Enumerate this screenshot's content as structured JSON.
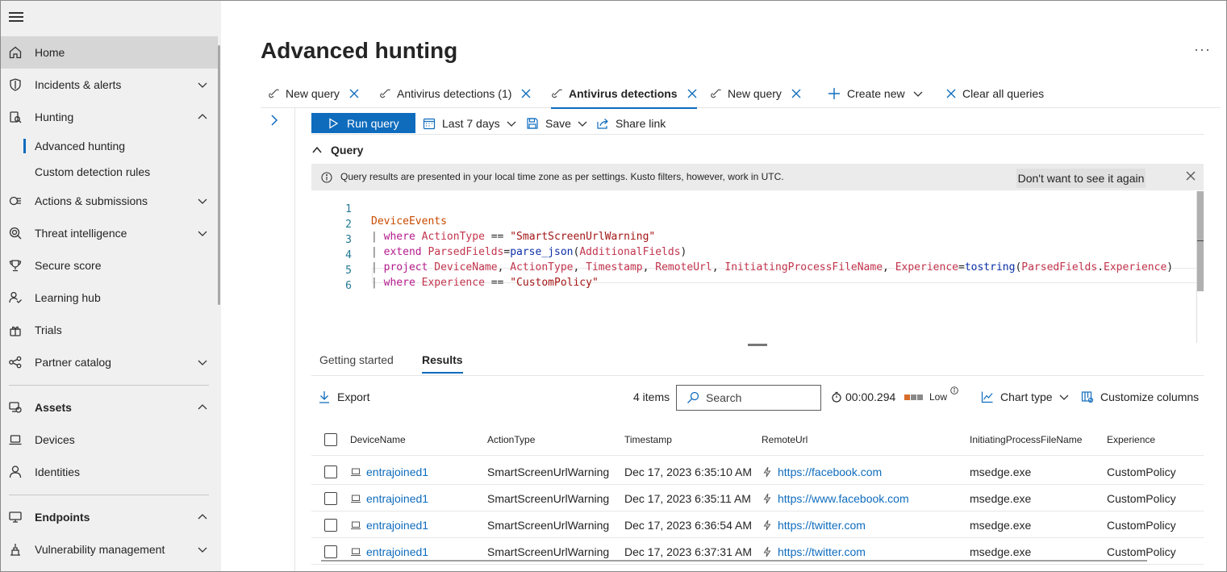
{
  "sidebar": {
    "items": [
      {
        "label": "Home",
        "icon": "home-icon"
      },
      {
        "label": "Incidents & alerts",
        "icon": "shield-icon"
      },
      {
        "label": "Hunting",
        "icon": "hunting-icon"
      },
      {
        "label": "Advanced hunting"
      },
      {
        "label": "Custom detection rules"
      },
      {
        "label": "Actions & submissions",
        "icon": "actions-icon"
      },
      {
        "label": "Threat intelligence",
        "icon": "threat-intel-icon"
      },
      {
        "label": "Secure score",
        "icon": "trophy-icon"
      },
      {
        "label": "Learning hub",
        "icon": "learning-icon"
      },
      {
        "label": "Trials",
        "icon": "trials-icon"
      },
      {
        "label": "Partner catalog",
        "icon": "partner-icon"
      },
      {
        "label": "Assets",
        "icon": "assets-icon"
      },
      {
        "label": "Devices",
        "icon": "laptop-icon"
      },
      {
        "label": "Identities",
        "icon": "person-icon"
      },
      {
        "label": "Endpoints",
        "icon": "endpoints-icon"
      },
      {
        "label": "Vulnerability management",
        "icon": "vuln-icon"
      }
    ]
  },
  "page": {
    "title": "Advanced hunting",
    "more": "···"
  },
  "query_tabs": [
    {
      "label": "New query"
    },
    {
      "label": "Antivirus detections (1)"
    },
    {
      "label": "Antivirus detections"
    },
    {
      "label": "New query"
    }
  ],
  "tab_actions": {
    "create_new": "Create new",
    "clear_all": "Clear all queries"
  },
  "toolbar": {
    "run": "Run query",
    "range": "Last 7 days",
    "save": "Save",
    "share": "Share link"
  },
  "query_section": {
    "title": "Query",
    "info_text": "Query results are presented in your local time zone as per settings. Kusto filters, however, work in UTC.",
    "info_button": "Don't want to see it again"
  },
  "code": {
    "line_numbers": [
      "1",
      "2",
      "3",
      "4",
      "5",
      "6"
    ],
    "l1": "DeviceEvents",
    "l2_kw": "where",
    "l2_fld": "ActionType",
    "l2_op": "==",
    "l2_str": "\"SmartScreenUrlWarning\"",
    "l3_kw": "extend",
    "l3_fld": "ParsedFields",
    "l3_fn": "parse_json",
    "l3_arg": "AdditionalFields",
    "l4_kw": "project",
    "l4_f1": "DeviceName",
    "l4_f2": "ActionType",
    "l4_f3": "Timestamp",
    "l4_f4": "RemoteUrl",
    "l4_f5": "InitiatingProcessFileName",
    "l4_f6": "Experience",
    "l4_fn": "tostring",
    "l4_a1": "ParsedFields",
    "l4_a2": "Experience",
    "l5_kw": "where",
    "l5_fld": "Experience",
    "l5_op": "==",
    "l5_str": "\"CustomPolicy\""
  },
  "result_tabs": {
    "getting_started": "Getting started",
    "results": "Results"
  },
  "results_toolbar": {
    "export": "Export",
    "count": "4 items",
    "search_placeholder": "Search",
    "duration": "00:00.294",
    "usage": "Low",
    "chart_type": "Chart type",
    "customize": "Customize columns"
  },
  "table": {
    "columns": [
      "DeviceName",
      "ActionType",
      "Timestamp",
      "RemoteUrl",
      "InitiatingProcessFileName",
      "Experience"
    ],
    "rows": [
      {
        "device": "entrajoined1",
        "action": "SmartScreenUrlWarning",
        "time": "Dec 17, 2023 6:35:10 AM",
        "url": "https://facebook.com",
        "proc": "msedge.exe",
        "exp": "CustomPolicy"
      },
      {
        "device": "entrajoined1",
        "action": "SmartScreenUrlWarning",
        "time": "Dec 17, 2023 6:35:11 AM",
        "url": "https://www.facebook.com",
        "proc": "msedge.exe",
        "exp": "CustomPolicy"
      },
      {
        "device": "entrajoined1",
        "action": "SmartScreenUrlWarning",
        "time": "Dec 17, 2023 6:36:54 AM",
        "url": "https://twitter.com",
        "proc": "msedge.exe",
        "exp": "CustomPolicy"
      },
      {
        "device": "entrajoined1",
        "action": "SmartScreenUrlWarning",
        "time": "Dec 17, 2023 6:37:31 AM",
        "url": "https://twitter.com",
        "proc": "msedge.exe",
        "exp": "CustomPolicy"
      }
    ]
  },
  "colors": {
    "accent": "#0f6cbd",
    "sidebar_bg": "#f0f0f0",
    "usage_orange": "#d86c2a",
    "usage_gray": "#8a8a8a"
  }
}
